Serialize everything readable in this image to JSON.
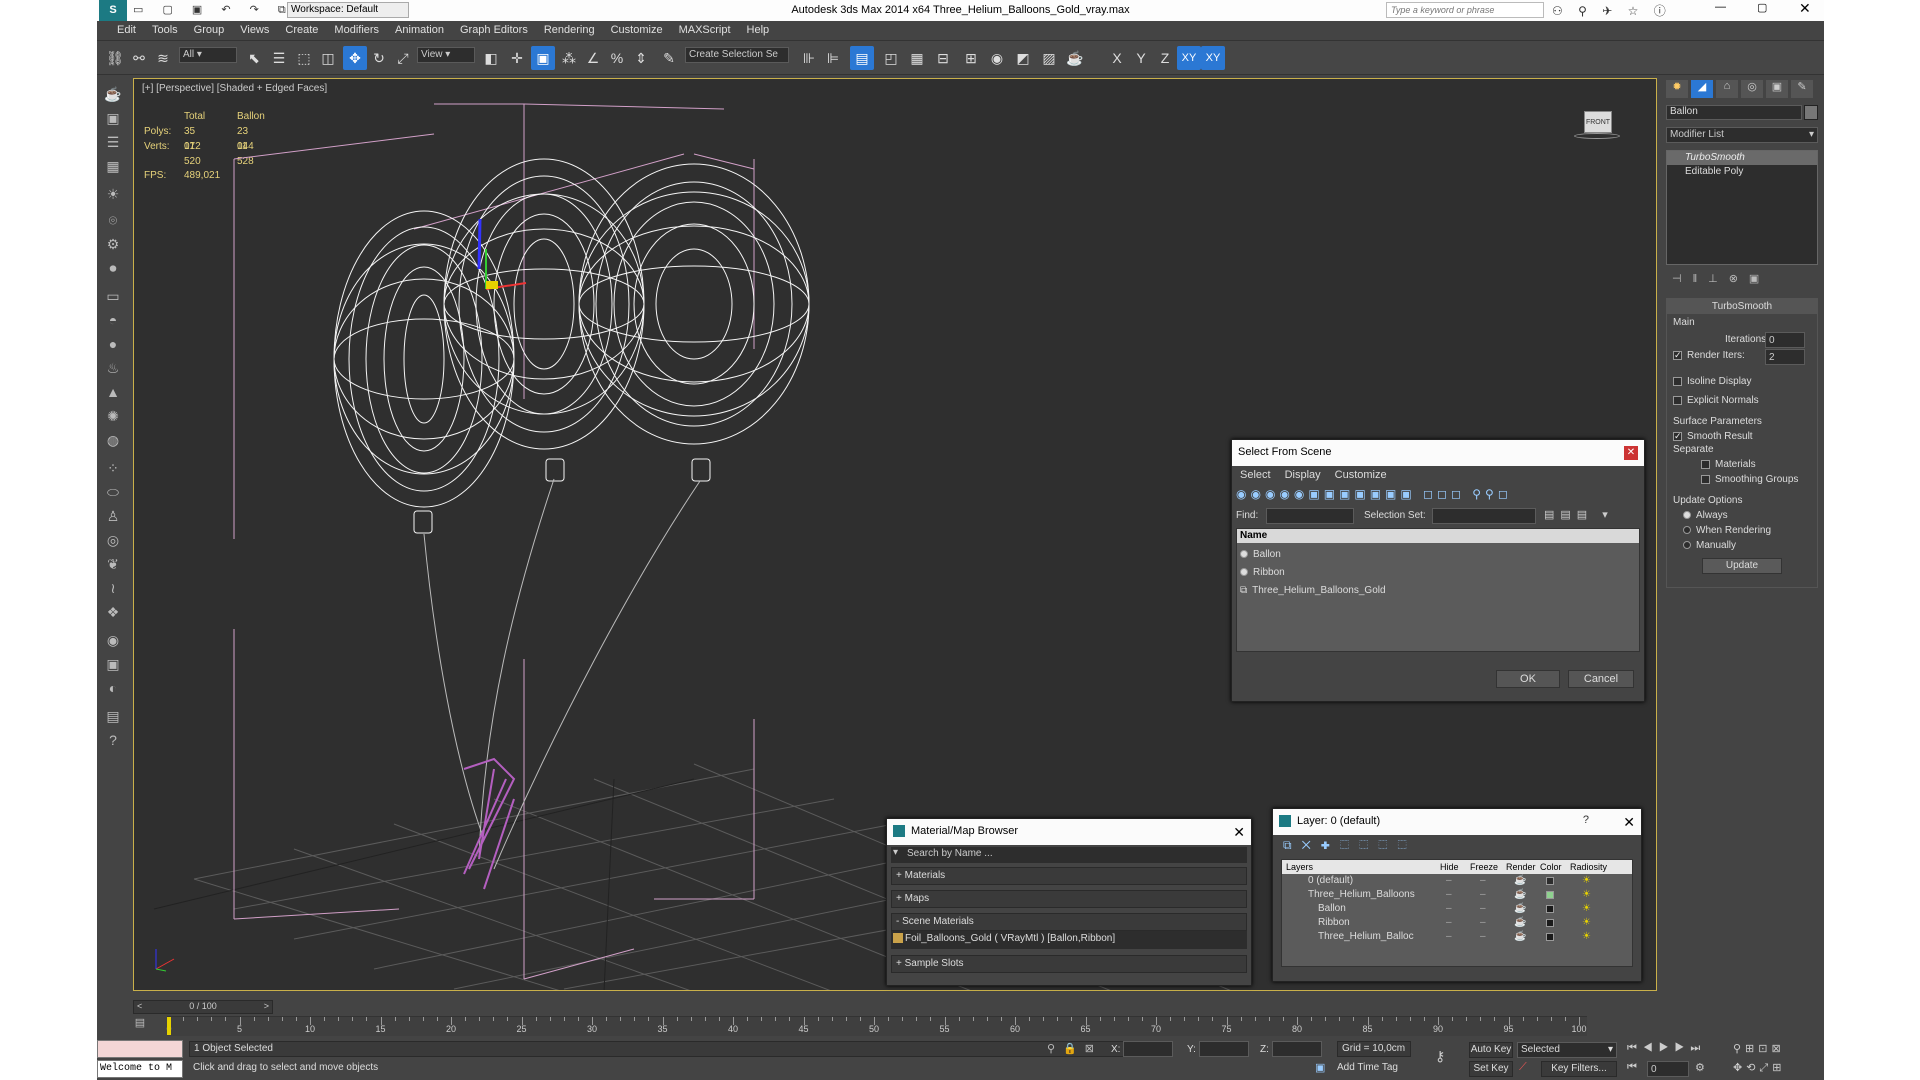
{
  "titlebar": {
    "title": "Autodesk 3ds Max  2014 x64     Three_Helium_Balloons_Gold_vray.max",
    "workspace": "Workspace: Default",
    "search_placeholder": "Type a keyword or phrase"
  },
  "menu": [
    "Edit",
    "Tools",
    "Group",
    "Views",
    "Create",
    "Modifiers",
    "Animation",
    "Graph Editors",
    "Rendering",
    "Customize",
    "MAXScript",
    "Help"
  ],
  "toolbar": {
    "filter": "All",
    "refcoord": "View",
    "selset": "Create Selection Se",
    "axis_x": "X",
    "axis_y": "Y",
    "axis_z": "Z",
    "axis_xy": "XY",
    "axis_xy2": "XY"
  },
  "viewport": {
    "label": "[+] [Perspective] [Shaded + Edged Faces]",
    "stats": {
      "h_total": "Total",
      "h_obj": "Ballon",
      "polys_label": "Polys:",
      "polys_total": "35 012",
      "polys_obj": "23 044",
      "verts_label": "Verts:",
      "verts_total": "17 520",
      "verts_obj": "11 528",
      "fps_label": "FPS:",
      "fps": "489,021"
    }
  },
  "select_dialog": {
    "title": "Select From Scene",
    "menu": [
      "Select",
      "Display",
      "Customize"
    ],
    "find_label": "Find:",
    "selset_label": "Selection Set:",
    "col_name": "Name",
    "items": [
      "Ballon",
      "Ribbon",
      "Three_Helium_Balloons_Gold"
    ],
    "ok": "OK",
    "cancel": "Cancel"
  },
  "material_browser": {
    "title": "Material/Map Browser",
    "search_placeholder": "Search by Name ...",
    "sections": [
      "+ Materials",
      "+ Maps",
      "- Scene Materials"
    ],
    "scene_item": "Foil_Balloons_Gold  ( VRayMtl ) [Ballon,Ribbon]",
    "sample_slots": "+ Sample Slots"
  },
  "layer_dialog": {
    "title": "Layer: 0 (default)",
    "help": "?",
    "cols": [
      "Layers",
      "Hide",
      "Freeze",
      "Render",
      "Color",
      "Radiosity"
    ],
    "rows": [
      {
        "name": "0 (default)",
        "indent": 0,
        "color": "#2d2d2d"
      },
      {
        "name": "Three_Helium_Balloons",
        "indent": 0,
        "color": "#8fd18f"
      },
      {
        "name": "Ballon",
        "indent": 1,
        "color": "#1b1b1b"
      },
      {
        "name": "Ribbon",
        "indent": 1,
        "color": "#1b1b1b"
      },
      {
        "name": "Three_Helium_Balloc",
        "indent": 1,
        "color": "#1b1b1b"
      }
    ]
  },
  "right_panel": {
    "object_name": "Ballon",
    "modifier_list": "Modifier List",
    "stack": [
      "TurboSmooth",
      "Editable Poly"
    ],
    "rollout": "TurboSmooth",
    "main": "Main",
    "iterations_label": "Iterations:",
    "iterations": "0",
    "render_iters_label": "Render Iters:",
    "render_iters": "2",
    "isoline": "Isoline Display",
    "explicit": "Explicit Normals",
    "surface": "Surface Parameters",
    "smooth": "Smooth Result",
    "separate": "Separate",
    "materials": "Materials",
    "smoothing": "Smoothing Groups",
    "update_opts": "Update Options",
    "always": "Always",
    "when_rendering": "When Rendering",
    "manually": "Manually",
    "update": "Update"
  },
  "timeline": {
    "frame": "0 / 100",
    "ticks": [
      "0",
      "5",
      "10",
      "15",
      "20",
      "25",
      "30",
      "35",
      "40",
      "45",
      "50",
      "55",
      "60",
      "65",
      "70",
      "75",
      "80",
      "85",
      "90",
      "95",
      "100"
    ]
  },
  "status": {
    "listener": "Welcome to M",
    "selected": "1 Object Selected",
    "prompt": "Click and drag to select and move objects",
    "x": "X:",
    "y": "Y:",
    "z": "Z:",
    "grid": "Grid = 10,0cm",
    "add_time_tag": "Add Time Tag",
    "auto_key": "Auto Key",
    "set_key": "Set Key",
    "selected_dd": "Selected",
    "key_filters": "Key Filters...",
    "frame_field": "0"
  }
}
